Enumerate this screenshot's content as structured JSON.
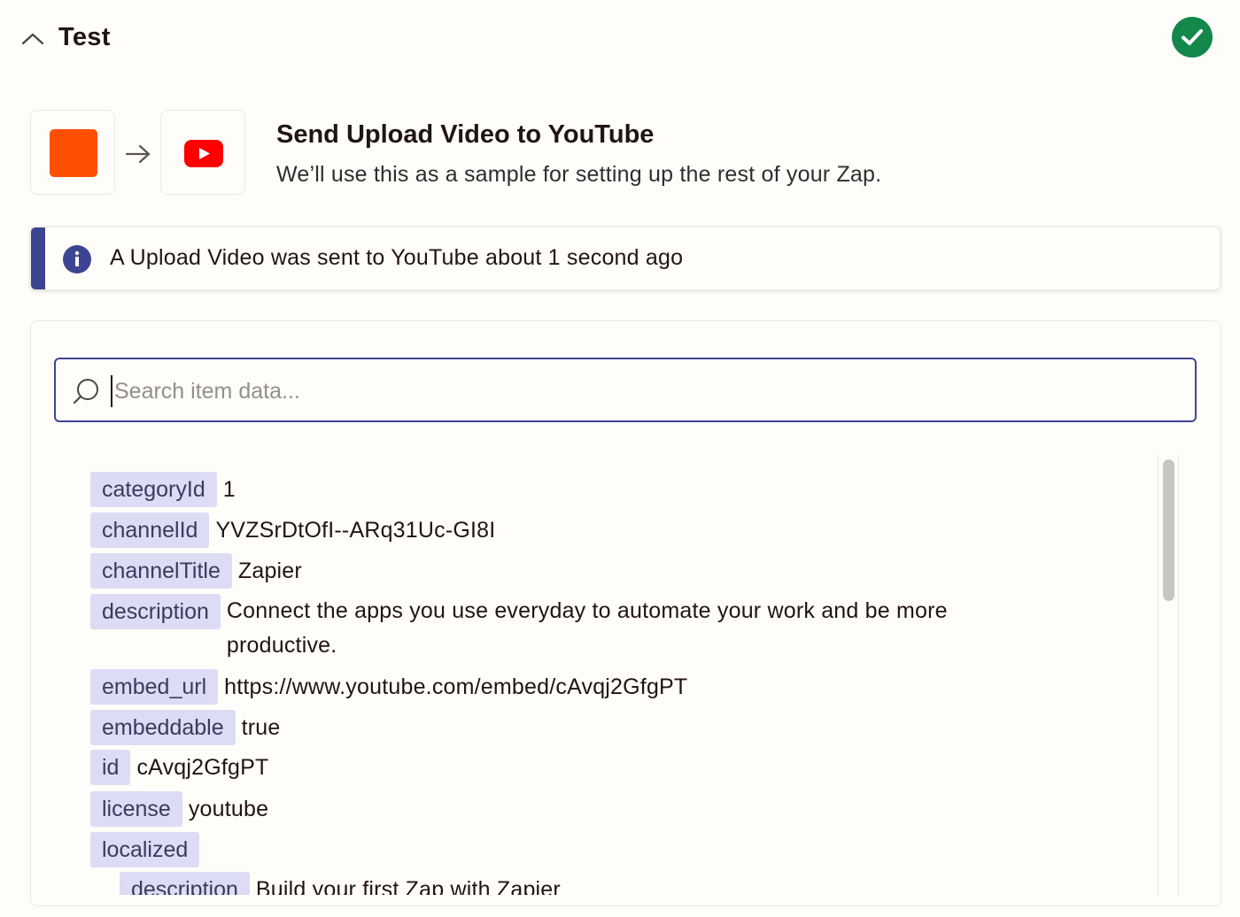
{
  "header": {
    "title": "Test",
    "status": "success"
  },
  "step": {
    "trigger_app_color": "#ff4f00",
    "action_app": "youtube-icon",
    "title": "Send Upload Video to YouTube",
    "subtitle": "We’ll use this as a sample for setting up the rest of your Zap."
  },
  "banner": {
    "text": "A Upload Video was sent to YouTube about 1 second ago"
  },
  "search": {
    "placeholder": "Search item data...",
    "value": ""
  },
  "items": [
    {
      "key": "categoryId",
      "value": "1"
    },
    {
      "key": "channelId",
      "value": "YVZSrDtOfI--ARq31Uc-GI8I"
    },
    {
      "key": "channelTitle",
      "value": "Zapier"
    },
    {
      "key": "description",
      "value": "Connect the apps you use everyday to automate your work and be more productive."
    },
    {
      "key": "embed_url",
      "value": "https://www.youtube.com/embed/cAvqj2GfgPT"
    },
    {
      "key": "embeddable",
      "value": "true"
    },
    {
      "key": "id",
      "value": "cAvqj2GfgPT"
    },
    {
      "key": "license",
      "value": "youtube"
    },
    {
      "key": "localized",
      "value": ""
    },
    {
      "key": "description",
      "value": "Build your first Zap with Zapier"
    }
  ],
  "colors": {
    "accent": "#3d4592",
    "success": "#13884a",
    "key_bg": "#dcdcf5",
    "zapier_orange": "#ff4f00",
    "youtube_red": "#ff0000"
  }
}
